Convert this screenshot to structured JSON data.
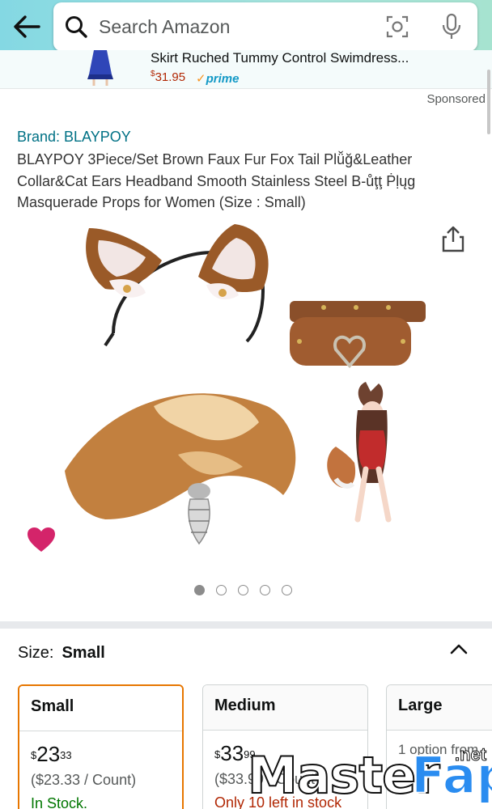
{
  "search": {
    "placeholder": "Search Amazon"
  },
  "ad": {
    "title": "Skirt Ruched Tummy Control Swimdress...",
    "price_symbol": "$",
    "price": "31.95",
    "prime_label": "prime"
  },
  "sponsored_label": "Sponsored",
  "product": {
    "brand": "Brand: BLAYPOY",
    "title": "BLAYPOY 3Piece/Set Brown Faux Fur Fox Tail Plǚğ&Leather Collar&Cat Ears Headband Smooth Stainless Steel B-ůţţ Ṗḷųg Masquerade Props for Women (Size : Small)"
  },
  "gallery": {
    "image_count": 5,
    "active_index": 0
  },
  "size": {
    "label": "Size:",
    "selected": "Small"
  },
  "size_options": [
    {
      "name": "Small",
      "currency": "$",
      "whole": "23",
      "fraction": "33",
      "unit_price": "($23.33 / Count)",
      "stock": "In Stock.",
      "stock_color": "#007600",
      "selected": true
    },
    {
      "name": "Medium",
      "currency": "$",
      "whole": "33",
      "fraction": "99",
      "unit_price": "($33.99 / Count)",
      "stock": "Only 10 left in stock",
      "stock_color": "#b12704",
      "selected": false
    },
    {
      "name": "Large",
      "options_text": "1 option from",
      "selected": false
    }
  ],
  "colors": {
    "link": "#007185",
    "price_red": "#b12704",
    "selected_border": "#e77600",
    "heart": "#d4246a"
  },
  "watermark": {
    "main": "Master",
    "accent": "Fap",
    "suffix": ".net"
  }
}
